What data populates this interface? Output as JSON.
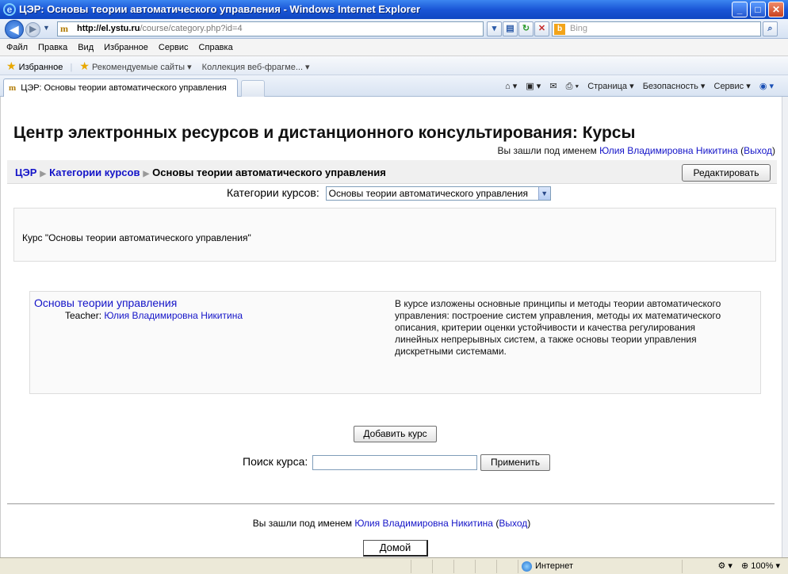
{
  "window": {
    "title": "ЦЭР: Основы теории автоматического управления - Windows Internet Explorer"
  },
  "address": {
    "url_domain": "http://el.ystu.ru",
    "url_path": "/course/category.php?id=4",
    "search_placeholder": "Bing"
  },
  "menu": [
    "Файл",
    "Правка",
    "Вид",
    "Избранное",
    "Сервис",
    "Справка"
  ],
  "favorites": {
    "label": "Избранное",
    "items": [
      "Рекомендуемые сайты ▾",
      "Коллекция веб-фрагме... ▾"
    ]
  },
  "tab": {
    "title": "ЦЭР: Основы теории автоматического управления"
  },
  "command_bar": [
    "Страница ▾",
    "Безопасность ▾",
    "Сервис ▾"
  ],
  "page": {
    "site_title": "Центр электронных ресурсов и дистанционного консультирования: Курсы",
    "login_prefix": "Вы зашли под именем",
    "user_name": "Юлия Владимировна Никитина",
    "logout": "Выход",
    "breadcrumb": {
      "home": "ЦЭР",
      "categories": "Категории курсов",
      "current": "Основы теории автоматического управления"
    },
    "edit_button": "Редактировать",
    "category_label": "Категории курсов:",
    "category_selected": "Основы теории автоматического управления",
    "category_summary": "Курс \"Основы теории автоматического управления\"",
    "course": {
      "name": "Основы теории управления",
      "teacher_label": "Teacher:",
      "teacher_name": "Юлия Владимировна Никитина",
      "summary": "В курсе изложены основные принципы и методы теории автоматического управления: построение систем управления, методы их математического описания, критерии оценки устойчивости и качества регулирования линейных непрерывных систем, а также основы теории управления дискретными системами."
    },
    "add_course_button": "Добавить курс",
    "search_label": "Поиск курса:",
    "search_value": "",
    "apply_button": "Применить",
    "home_button": "Домой"
  },
  "status": {
    "zone": "Интернет",
    "zoom": "100%"
  }
}
